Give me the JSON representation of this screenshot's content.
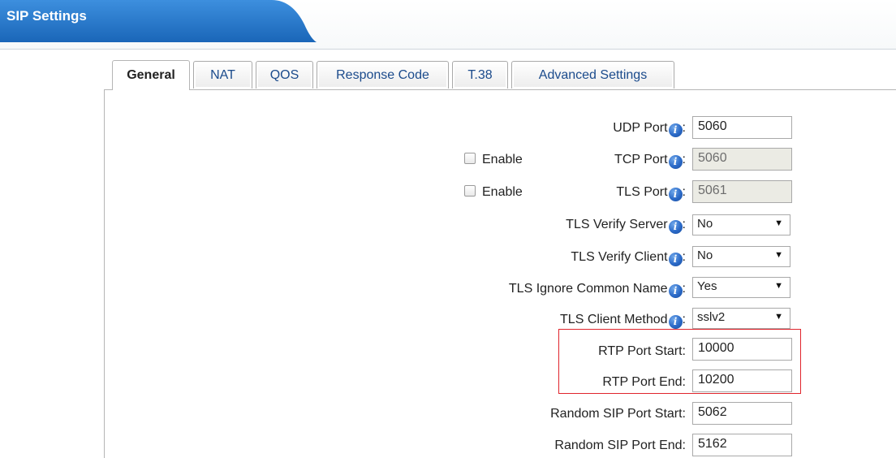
{
  "header": {
    "title": "SIP Settings"
  },
  "tabs": [
    {
      "label": "General",
      "active": true
    },
    {
      "label": "NAT",
      "active": false
    },
    {
      "label": "QOS",
      "active": false
    },
    {
      "label": "Response Code",
      "active": false
    },
    {
      "label": "T.38",
      "active": false
    },
    {
      "label": "Advanced Settings",
      "active": false
    }
  ],
  "form": {
    "enable_label": "Enable",
    "udp_port": {
      "label": "UDP Port",
      "suffix": ":",
      "value": "5060"
    },
    "tcp_port": {
      "label": "TCP Port",
      "suffix": ":",
      "value": "5060"
    },
    "tls_port": {
      "label": "TLS Port",
      "suffix": ":",
      "value": "5061"
    },
    "tls_verify_server": {
      "label": "TLS Verify Server",
      "suffix": ":",
      "value": "No"
    },
    "tls_verify_client": {
      "label": "TLS Verify Client",
      "suffix": ":",
      "value": "No"
    },
    "tls_ignore_common_name": {
      "label": "TLS Ignore Common Name",
      "suffix": ":",
      "value": "Yes"
    },
    "tls_client_method": {
      "label": "TLS Client Method",
      "suffix": ":",
      "value": "sslv2"
    },
    "rtp_port_start": {
      "label": "RTP Port Start:",
      "value": "10000"
    },
    "rtp_port_end": {
      "label": "RTP Port End:",
      "value": "10200"
    },
    "random_sip_port_start": {
      "label": "Random SIP Port Start:",
      "value": "5062"
    },
    "random_sip_port_end": {
      "label": "Random SIP Port End:",
      "value": "5162"
    }
  },
  "icons": {
    "info": "info-icon",
    "dropdown": "dropdown-arrow-icon"
  },
  "colors": {
    "header_blue": "#1f72c4",
    "highlight_red": "#e0242c",
    "tab_text": "#1b4b8c"
  }
}
